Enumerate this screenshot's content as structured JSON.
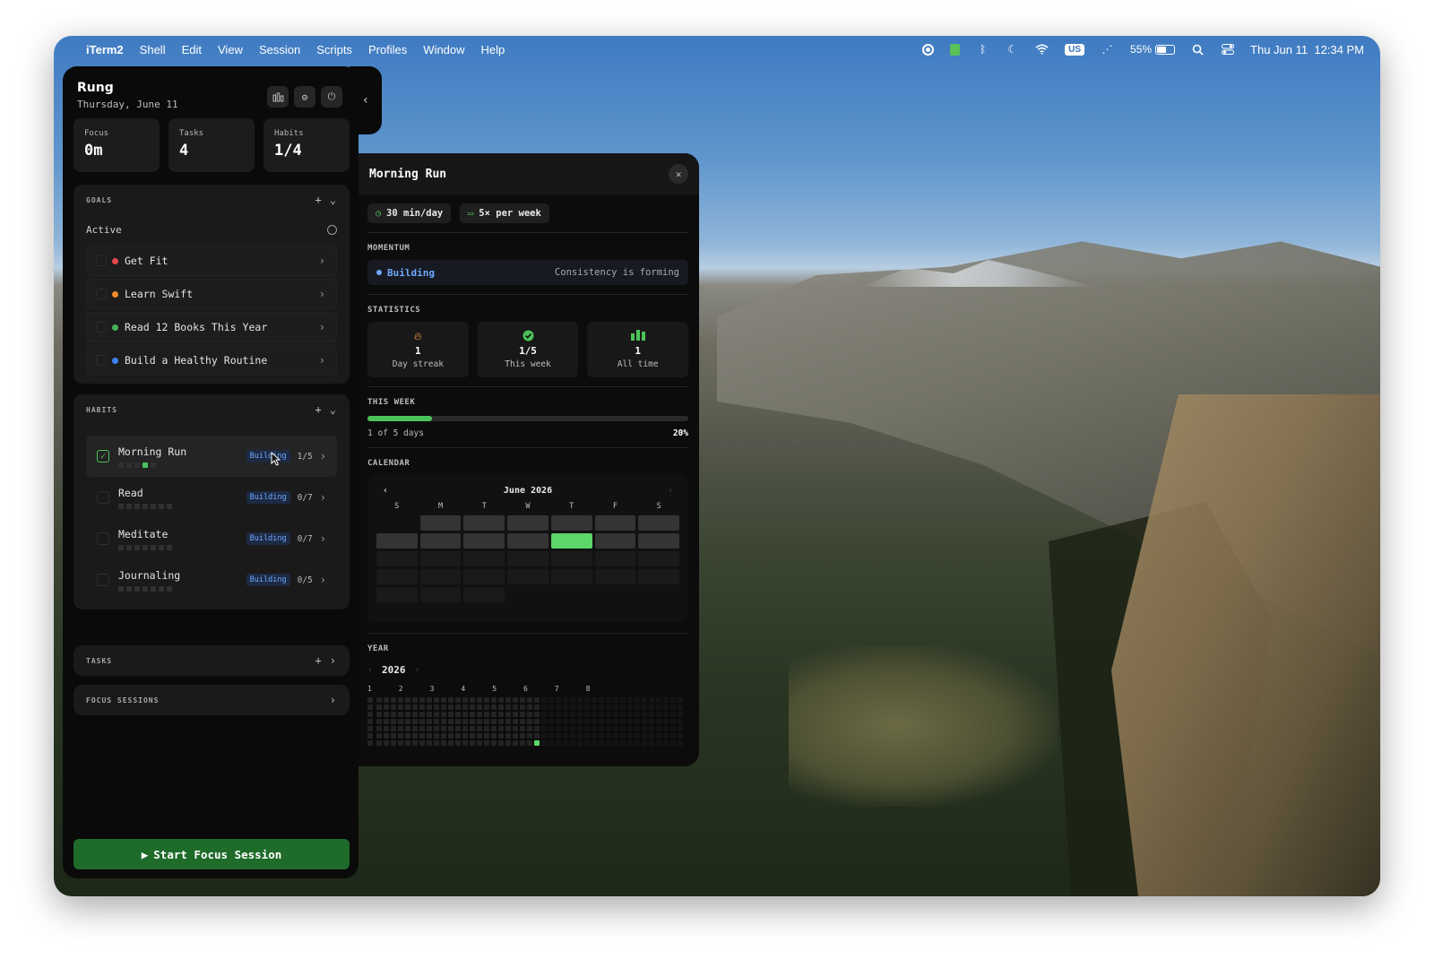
{
  "menubar": {
    "app_name": "iTerm2",
    "menus": [
      "Shell",
      "Edit",
      "View",
      "Session",
      "Scripts",
      "Profiles",
      "Window",
      "Help"
    ],
    "input_source": "US",
    "battery": "55%",
    "datetime": "Thu Jun 11  12:34 PM"
  },
  "sidebar": {
    "title": "Rung",
    "date": "Thursday, June 11",
    "stats": [
      {
        "label": "Focus",
        "value": "0m"
      },
      {
        "label": "Tasks",
        "value": "4"
      },
      {
        "label": "Habits",
        "value": "1/4"
      }
    ],
    "goals": {
      "header": "GOALS",
      "sub_label": "Active",
      "items": [
        {
          "label": "Get Fit",
          "color": "#e5484d"
        },
        {
          "label": "Learn Swift",
          "color": "#f08c2e"
        },
        {
          "label": "Read 12 Books This Year",
          "color": "#46b35a"
        },
        {
          "label": "Build a Healthy Routine",
          "color": "#3b82f6"
        }
      ]
    },
    "habits": {
      "header": "HABITS",
      "items": [
        {
          "label": "Morning Run",
          "badge": "Building",
          "count": "1/5",
          "done": true,
          "dots": 5,
          "completed_dot": 3
        },
        {
          "label": "Read",
          "badge": "Building",
          "count": "0/7",
          "done": false,
          "dots": 7,
          "completed_dot": -1
        },
        {
          "label": "Meditate",
          "badge": "Building",
          "count": "0/7",
          "done": false,
          "dots": 7,
          "completed_dot": -1
        },
        {
          "label": "Journaling",
          "badge": "Building",
          "count": "0/5",
          "done": false,
          "dots": 7,
          "completed_dot": -1
        }
      ]
    },
    "tasks_header": "TASKS",
    "focus_header": "FOCUS SESSIONS",
    "start_button": "Start Focus Session"
  },
  "detail": {
    "title": "Morning Run",
    "chips": [
      {
        "icon": "clock-icon",
        "label": "30 min/day"
      },
      {
        "icon": "calendar-icon",
        "label": "5× per week"
      }
    ],
    "momentum": {
      "label": "MOMENTUM",
      "status": "Building",
      "note": "Consistency is forming",
      "status_color": "#6fa8ff"
    },
    "statistics": {
      "label": "STATISTICS",
      "items": [
        {
          "icon": "flame-icon",
          "value": "1",
          "label": "Day streak"
        },
        {
          "icon": "check-circle-icon",
          "value": "1/5",
          "label": "This week"
        },
        {
          "icon": "bar-chart-icon",
          "value": "1",
          "label": "All time"
        }
      ]
    },
    "this_week": {
      "label": "THIS WEEK",
      "summary": "1 of 5 days",
      "percent": "20%",
      "progress": 0.2
    },
    "calendar": {
      "label": "CALENDAR",
      "month": "June 2026",
      "weekdays": [
        "S",
        "M",
        "T",
        "W",
        "T",
        "F",
        "S"
      ],
      "first_weekday": 1,
      "days_in_month": 30,
      "completed_days": [
        11
      ]
    },
    "year": {
      "label": "YEAR",
      "value": "2026",
      "month_labels": [
        "1",
        "2",
        "3",
        "4",
        "5",
        "6",
        "7",
        "8"
      ],
      "completed_week": 23
    },
    "accent": "#4cc25a"
  }
}
